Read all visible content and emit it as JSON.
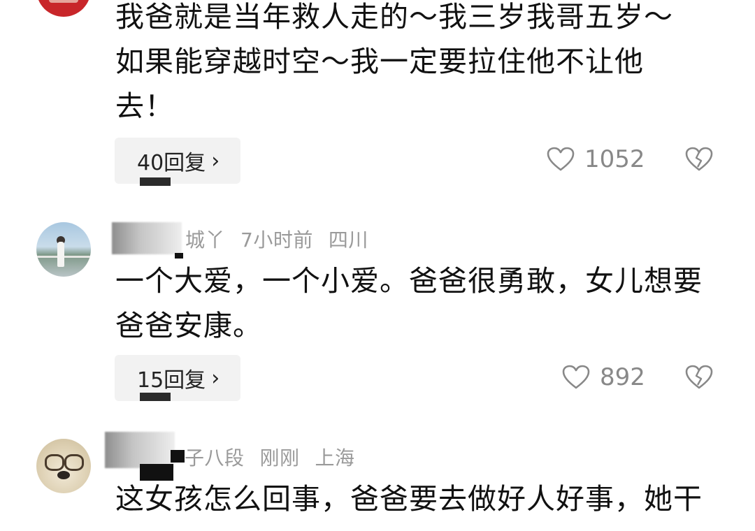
{
  "comments": [
    {
      "text_lines": [
        "我爸就是当年救人走的～我三岁我哥五岁～",
        "如果能穿越时空～我一定要拉住他不让他",
        "去！"
      ],
      "reply_label": "40回复",
      "likes": "1052"
    },
    {
      "username_visible": "城丫",
      "time": "7小时前",
      "location": "四川",
      "text_lines": [
        "一个大爱，一个小爱。爸爸很勇敢，女儿想要",
        "爸爸安康。"
      ],
      "reply_label": "15回复",
      "likes": "892"
    },
    {
      "username_visible": "子八段",
      "time": "刚刚",
      "location": "上海",
      "text_lines": [
        "这女孩怎么回事，爸爸要去做好人好事，她干"
      ]
    }
  ],
  "icons": {
    "chevron": "›",
    "like": "heart-outline-icon",
    "dislike": "broken-heart-icon"
  },
  "colors": {
    "text": "#111111",
    "meta": "#9a9a9a",
    "reply_bg": "#f2f2f2",
    "like": "#888888"
  }
}
